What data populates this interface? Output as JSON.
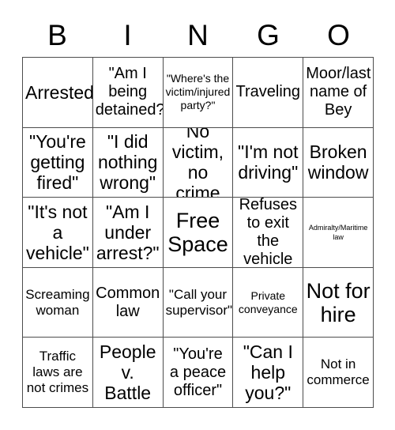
{
  "card": {
    "title_letters": [
      "B",
      "I",
      "N",
      "G",
      "O"
    ],
    "rows": [
      [
        {
          "text": "Arrested",
          "size": "sz-lg"
        },
        {
          "text": "\"Am I\nbeing\ndetained?\"",
          "size": "sz-md"
        },
        {
          "text": "\"Where's the\nvictim/injured\nparty?\"",
          "size": "sz-xs"
        },
        {
          "text": "Traveling",
          "size": "sz-md"
        },
        {
          "text": "Moor/last\nname of\nBey",
          "size": "sz-md"
        }
      ],
      [
        {
          "text": "\"You're\ngetting\nfired\"",
          "size": "sz-lg"
        },
        {
          "text": "\"I did\nnothing\nwrong\"",
          "size": "sz-lg"
        },
        {
          "text": "No\nvictim,\nno crime",
          "size": "sz-lg"
        },
        {
          "text": "\"I'm not\ndriving\"",
          "size": "sz-lg"
        },
        {
          "text": "Broken\nwindow",
          "size": "sz-lg"
        }
      ],
      [
        {
          "text": "\"It's not\na\nvehicle\"",
          "size": "sz-lg"
        },
        {
          "text": "\"Am I\nunder\narrest?\"",
          "size": "sz-lg"
        },
        {
          "text": "Free\nSpace",
          "size": "sz-xl"
        },
        {
          "text": "Refuses\nto exit the\nvehicle",
          "size": "sz-md"
        },
        {
          "text": "Admiralty/Maritime\nlaw",
          "size": "sz-xxs"
        }
      ],
      [
        {
          "text": "Screaming\nwoman",
          "size": "sz-sm"
        },
        {
          "text": "Common\nlaw",
          "size": "sz-md"
        },
        {
          "text": "\"Call your\nsupervisor\"",
          "size": "sz-sm"
        },
        {
          "text": "Private\nconveyance",
          "size": "sz-xs"
        },
        {
          "text": "Not for\nhire",
          "size": "sz-xl"
        }
      ],
      [
        {
          "text": "Traffic\nlaws are\nnot crimes",
          "size": "sz-sm"
        },
        {
          "text": "People\nv.\nBattle",
          "size": "sz-lg"
        },
        {
          "text": "\"You're\na peace\nofficer\"",
          "size": "sz-md"
        },
        {
          "text": "\"Can I\nhelp\nyou?\"",
          "size": "sz-lg"
        },
        {
          "text": "Not in\ncommerce",
          "size": "sz-sm"
        }
      ]
    ]
  }
}
